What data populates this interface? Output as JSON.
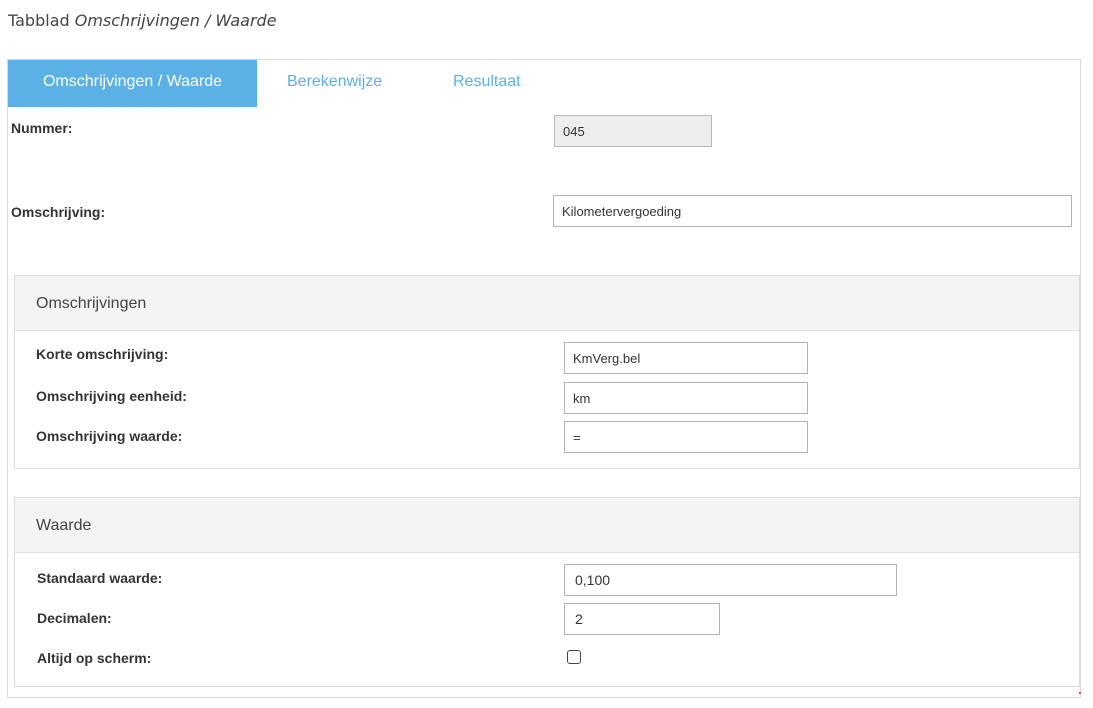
{
  "caption": {
    "prefix": "Tabblad ",
    "italic": "Omschrijvingen / Waarde"
  },
  "tabs": [
    {
      "label": "Omschrijvingen / Waarde",
      "active": true
    },
    {
      "label": "Berekenwijze",
      "active": false
    },
    {
      "label": "Resultaat",
      "active": false
    }
  ],
  "general": {
    "nummer_label": "Nummer:",
    "nummer_value": "045",
    "omschrijving_label": "Omschrijving:",
    "omschrijving_value": "Kilometervergoeding"
  },
  "omschrijvingen_panel": {
    "title": "Omschrijvingen",
    "korte_label": "Korte omschrijving:",
    "korte_value": "KmVerg.bel",
    "eenheid_label": "Omschrijving eenheid:",
    "eenheid_value": "km",
    "waarde_label": "Omschrijving waarde:",
    "waarde_value": "="
  },
  "waarde_panel": {
    "title": "Waarde",
    "standaard_label": "Standaard waarde:",
    "standaard_value": "0,100",
    "decimalen_label": "Decimalen:",
    "decimalen_value": "2",
    "altijd_label": "Altijd op scherm:",
    "altijd_checked": false
  },
  "colors": {
    "accent": "#5bb1e6",
    "panel_header": "#f4f4f4",
    "readonly_field": "#ededed"
  }
}
